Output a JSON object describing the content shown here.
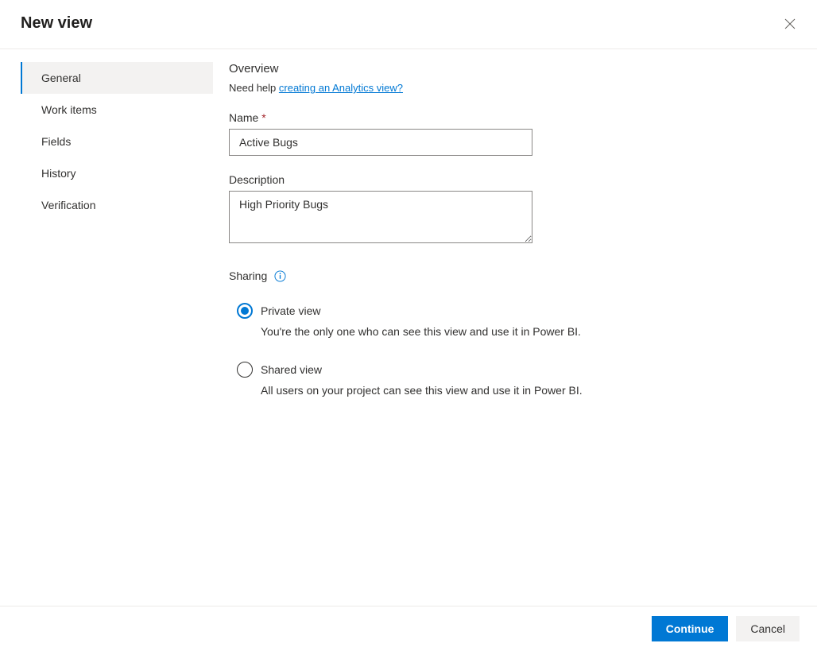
{
  "header": {
    "title": "New view"
  },
  "sidebar": {
    "items": [
      {
        "label": "General",
        "active": true
      },
      {
        "label": "Work items",
        "active": false
      },
      {
        "label": "Fields",
        "active": false
      },
      {
        "label": "History",
        "active": false
      },
      {
        "label": "Verification",
        "active": false
      }
    ]
  },
  "main": {
    "overview_title": "Overview",
    "help_prefix": "Need help ",
    "help_link": "creating an Analytics view?",
    "name_label": "Name",
    "name_value": "Active Bugs",
    "description_label": "Description",
    "description_value": "High Priority Bugs",
    "sharing_label": "Sharing",
    "radio_private_label": "Private view",
    "radio_private_desc": "You're the only one who can see this view and use it in Power BI.",
    "radio_shared_label": "Shared view",
    "radio_shared_desc": "All users on your project can see this view and use it in Power BI."
  },
  "footer": {
    "continue_label": "Continue",
    "cancel_label": "Cancel"
  }
}
